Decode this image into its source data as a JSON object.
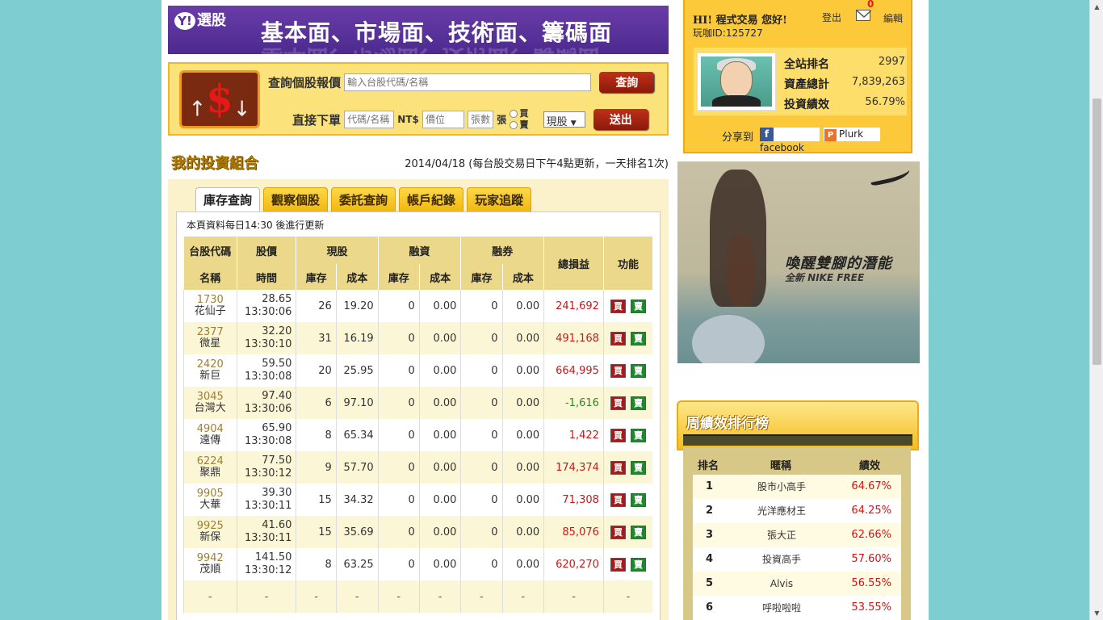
{
  "banner": {
    "logo": "選股",
    "logo_y": "Y!",
    "slogan": "基本面、市場面、技術面、籌碼面"
  },
  "query": {
    "label_quote": "查詢個股報價",
    "quote_placeholder": "輸入台股代碼/名稱",
    "btn_query": "查詢",
    "label_order": "直接下單",
    "code_placeholder": "代碼/名稱",
    "nt_label": "NT$",
    "price_placeholder": "價位",
    "qty_placeholder": "張數",
    "unit": "張",
    "buy": "買",
    "sell": "賣",
    "type_selected": "現股",
    "btn_send": "送出"
  },
  "portfolio": {
    "title": "我的投資組合",
    "date_note": "2014/04/18 (每台股交易日下午4點更新，一天排名1次)",
    "tabs": [
      "庫存查詢",
      "觀察個股",
      "委託查詢",
      "帳戶紀錄",
      "玩家追蹤"
    ],
    "note": "本頁資料每日14:30 後進行更新",
    "headers": {
      "code": "台股代碼",
      "price": "股價",
      "spot": "現股",
      "margin": "融資",
      "short": "融券",
      "total": "總損益",
      "func": "功能",
      "name": "名稱",
      "time": "時間",
      "stock": "庫存",
      "cost": "成本"
    },
    "rows": [
      {
        "code": "1730",
        "name": "花仙子",
        "price": "28.65",
        "time": "13:30:06",
        "s_qty": "26",
        "s_cost": "19.20",
        "m_qty": "0",
        "m_cost": "0.00",
        "sh_qty": "0",
        "sh_cost": "0.00",
        "pnl": "241,692",
        "sign": "pos"
      },
      {
        "code": "2377",
        "name": "微星",
        "price": "32.20",
        "time": "13:30:10",
        "s_qty": "31",
        "s_cost": "16.19",
        "m_qty": "0",
        "m_cost": "0.00",
        "sh_qty": "0",
        "sh_cost": "0.00",
        "pnl": "491,168",
        "sign": "pos"
      },
      {
        "code": "2420",
        "name": "新巨",
        "price": "59.50",
        "time": "13:30:08",
        "s_qty": "20",
        "s_cost": "25.95",
        "m_qty": "0",
        "m_cost": "0.00",
        "sh_qty": "0",
        "sh_cost": "0.00",
        "pnl": "664,995",
        "sign": "pos"
      },
      {
        "code": "3045",
        "name": "台灣大",
        "price": "97.40",
        "time": "13:30:06",
        "s_qty": "6",
        "s_cost": "97.10",
        "m_qty": "0",
        "m_cost": "0.00",
        "sh_qty": "0",
        "sh_cost": "0.00",
        "pnl": "-1,616",
        "sign": "neg"
      },
      {
        "code": "4904",
        "name": "遠傳",
        "price": "65.90",
        "time": "13:30:08",
        "s_qty": "8",
        "s_cost": "65.34",
        "m_qty": "0",
        "m_cost": "0.00",
        "sh_qty": "0",
        "sh_cost": "0.00",
        "pnl": "1,422",
        "sign": "pos"
      },
      {
        "code": "6224",
        "name": "聚鼎",
        "price": "77.50",
        "time": "13:30:12",
        "s_qty": "9",
        "s_cost": "57.70",
        "m_qty": "0",
        "m_cost": "0.00",
        "sh_qty": "0",
        "sh_cost": "0.00",
        "pnl": "174,374",
        "sign": "pos"
      },
      {
        "code": "9905",
        "name": "大華",
        "price": "39.30",
        "time": "13:30:11",
        "s_qty": "15",
        "s_cost": "34.32",
        "m_qty": "0",
        "m_cost": "0.00",
        "sh_qty": "0",
        "sh_cost": "0.00",
        "pnl": "71,308",
        "sign": "pos"
      },
      {
        "code": "9925",
        "name": "新保",
        "price": "41.60",
        "time": "13:30:11",
        "s_qty": "15",
        "s_cost": "35.69",
        "m_qty": "0",
        "m_cost": "0.00",
        "sh_qty": "0",
        "sh_cost": "0.00",
        "pnl": "85,076",
        "sign": "pos"
      },
      {
        "code": "9942",
        "name": "茂順",
        "price": "141.50",
        "time": "13:30:12",
        "s_qty": "8",
        "s_cost": "63.25",
        "m_qty": "0",
        "m_cost": "0.00",
        "sh_qty": "0",
        "sh_cost": "0.00",
        "pnl": "620,270",
        "sign": "pos"
      }
    ],
    "buy_btn": "買",
    "sell_btn": "賣",
    "dash": "-"
  },
  "user": {
    "greeting": "HI! 程式交易 您好!",
    "id_label": "玩咖ID:125727",
    "logout": "登出",
    "mail_count": "0",
    "edit": "編輯",
    "stats": [
      {
        "label": "全站排名",
        "value": "2997"
      },
      {
        "label": "資產總計",
        "value": "7,839,263"
      },
      {
        "label": "投資績效",
        "value": "56.79%"
      }
    ],
    "share_label": "分享到",
    "facebook": "facebook",
    "plurk": "Plurk"
  },
  "ad": {
    "headline": "喚醒雙腳的潛能",
    "sub": "全新 NIKE FREE"
  },
  "ranking": {
    "title": "周績效排行榜",
    "cols": {
      "rank": "排名",
      "nick": "暱稱",
      "perf": "績效"
    },
    "items": [
      {
        "n": "1",
        "name": "股市小高手",
        "pct": "64.67%"
      },
      {
        "n": "2",
        "name": "光洋應材王",
        "pct": "64.25%"
      },
      {
        "n": "3",
        "name": "張大正",
        "pct": "62.66%"
      },
      {
        "n": "4",
        "name": "投資高手",
        "pct": "57.60%"
      },
      {
        "n": "5",
        "name": "Alvis",
        "pct": "56.55%"
      },
      {
        "n": "6",
        "name": "呼啦啦啦",
        "pct": "53.55%"
      }
    ]
  },
  "colors": {
    "background": "#7ecdd1",
    "banner": "#5a2ea0",
    "gold": "#fbc93a",
    "profit": "#c81818",
    "loss": "#2a8a1a"
  }
}
